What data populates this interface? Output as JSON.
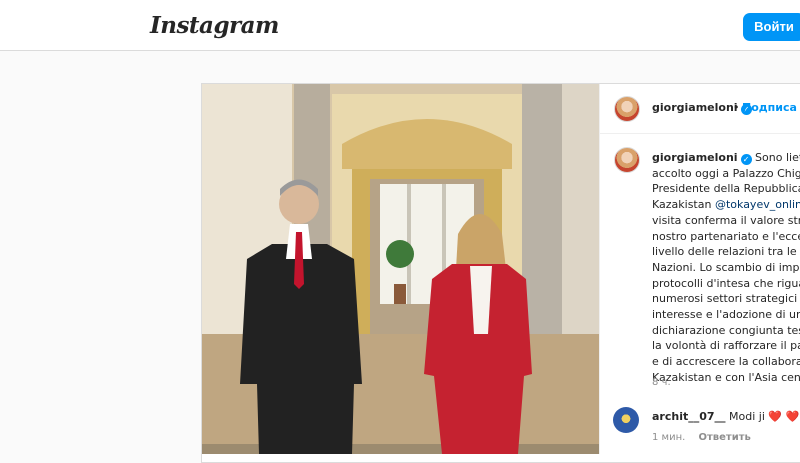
{
  "header": {
    "logo": "Instagram",
    "login_label": "Войти"
  },
  "post": {
    "username": "giorgiameloni",
    "follow_label": "Подписа",
    "caption_lines": [
      "Sono lieta d",
      "accolto oggi a Palazzo Chigi",
      "Presidente della Repubblica d",
      "Kazakistan",
      "visita conferma il valore strat",
      "nostro partenariato e l'eccelle",
      "livello delle relazioni tra le no",
      "Nazioni. Lo scambio di impor",
      "protocolli d'intesa che riguar",
      "numerosi settori strategici di",
      "interesse e l'adozione di una",
      "dichiarazione congiunta testi",
      "la volontà di rafforzare il part",
      "e di accrescere la collaborazi",
      "Kazakistan e con l'Asia centra"
    ],
    "mention": "@tokayev_online.",
    "time": "8 ч.",
    "comment": {
      "user": "archit__07__",
      "text": "Modi ji",
      "hearts": "❤️ ❤️",
      "time": "1 мин.",
      "reply": "Ответить"
    }
  }
}
